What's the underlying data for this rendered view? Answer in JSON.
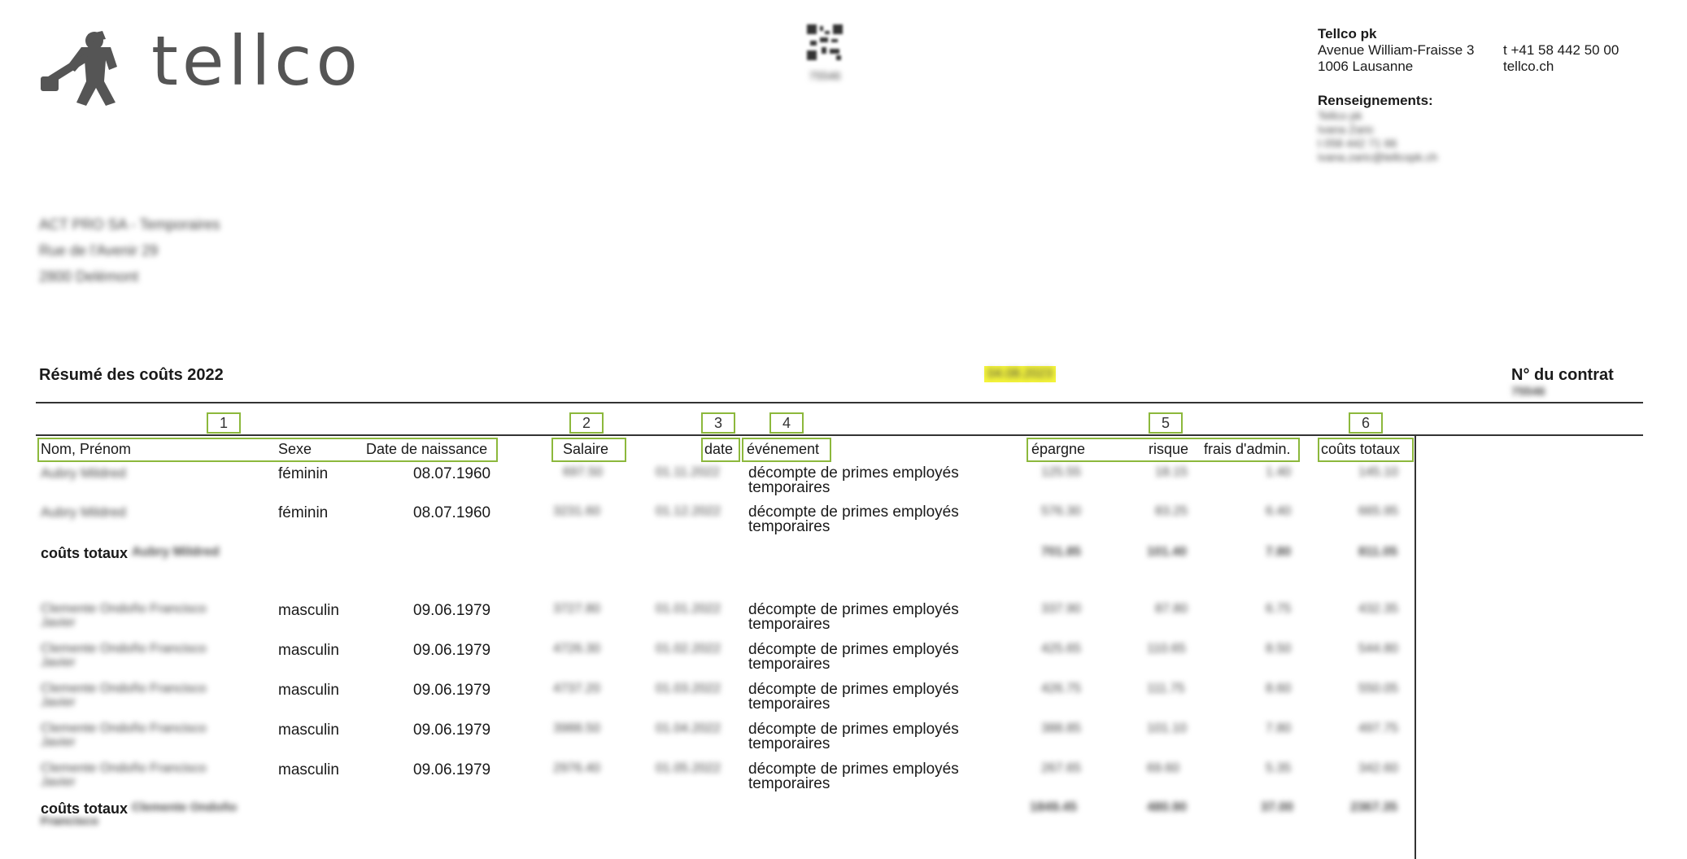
{
  "header": {
    "logo_text": "tellco",
    "qr_code_label": "75546",
    "company": {
      "name": "Tellco pk",
      "address_line1": "Avenue William-Fraisse 3",
      "address_line2": "1006 Lausanne",
      "phone": "t +41 58 442 50 00",
      "website": "tellco.ch",
      "info_label": "Renseignements:",
      "contact_line1": "Tellco pk",
      "contact_line2": "Ivana Zaric",
      "contact_line3": "t 058 442 71 66",
      "contact_line4": "ivana.zaric@tellcopk.ch"
    }
  },
  "recipient": {
    "line1": "ACT PRO SA - Temporaires",
    "line2": "Rue de l'Avenir 29",
    "line3": "2800 Delémont"
  },
  "summary": {
    "title": "Résumé des coûts 2022",
    "date": "04.08.2023",
    "contract_label": "N° du contrat",
    "contract_number": "75546"
  },
  "columns": {
    "numbers": [
      "1",
      "2",
      "3",
      "4",
      "5",
      "6"
    ],
    "name": "Nom, Prénom",
    "sex": "Sexe",
    "birth": "Date de naissance",
    "salary": "Salaire",
    "date": "date",
    "event": "événement",
    "savings": "épargne",
    "risk": "risque",
    "admin": "frais d'admin.",
    "total": "coûts totaux"
  },
  "groups": [
    {
      "rows": [
        {
          "name": "Aubry Mildred",
          "sex": "féminin",
          "birth": "08.07.1960",
          "salary": "697.50",
          "date": "01.11.2022",
          "event_line1": "décompte de primes employés",
          "event_line2": "temporaires",
          "savings": "125.55",
          "risk": "18.15",
          "admin": "1.40",
          "total": "145.10"
        },
        {
          "name": "Aubry Mildred",
          "sex": "féminin",
          "birth": "08.07.1960",
          "salary": "3231.60",
          "date": "01.12.2022",
          "event_line1": "décompte de primes employés",
          "event_line2": "temporaires",
          "savings": "576.30",
          "risk": "83.25",
          "admin": "6.40",
          "total": "665.95"
        }
      ],
      "total_label": "coûts totaux",
      "total_name": "Aubry Mildred",
      "totals": {
        "savings": "701.85",
        "risk": "101.40",
        "admin": "7.80",
        "total": "811.05"
      }
    },
    {
      "rows": [
        {
          "name_line1": "Clemente Ondoño Francisco",
          "name_line2": "Javier",
          "sex": "masculin",
          "birth": "09.06.1979",
          "salary": "3727.80",
          "date": "01.01.2022",
          "event_line1": "décompte de primes employés",
          "event_line2": "temporaires",
          "savings": "337.90",
          "risk": "87.80",
          "admin": "6.75",
          "total": "432.35"
        },
        {
          "name_line1": "Clemente Ondoño Francisco",
          "name_line2": "Javier",
          "sex": "masculin",
          "birth": "09.06.1979",
          "salary": "4726.30",
          "date": "01.02.2022",
          "event_line1": "décompte de primes employés",
          "event_line2": "temporaires",
          "savings": "425.65",
          "risk": "110.65",
          "admin": "8.50",
          "total": "544.80"
        },
        {
          "name_line1": "Clemente Ondoño Francisco",
          "name_line2": "Javier",
          "sex": "masculin",
          "birth": "09.06.1979",
          "salary": "4737.20",
          "date": "01.03.2022",
          "event_line1": "décompte de primes employés",
          "event_line2": "temporaires",
          "savings": "426.75",
          "risk": "111.75",
          "admin": "8.60",
          "total": "550.05"
        },
        {
          "name_line1": "Clemente Ondoño Francisco",
          "name_line2": "Javier",
          "sex": "masculin",
          "birth": "09.06.1979",
          "salary": "3988.50",
          "date": "01.04.2022",
          "event_line1": "décompte de primes employés",
          "event_line2": "temporaires",
          "savings": "388.85",
          "risk": "101.10",
          "admin": "7.80",
          "total": "497.75"
        },
        {
          "name_line1": "Clemente Ondoño Francisco",
          "name_line2": "Javier",
          "sex": "masculin",
          "birth": "09.06.1979",
          "salary": "2976.40",
          "date": "01.05.2022",
          "event_line1": "décompte de primes employés",
          "event_line2": "temporaires",
          "savings": "267.65",
          "risk": "69.60",
          "admin": "5.35",
          "total": "342.60"
        }
      ],
      "total_label": "coûts totaux",
      "total_name_line1": "Clemente Ondoño",
      "total_name_line2": "Francisco",
      "totals": {
        "savings": "1849.45",
        "risk": "480.90",
        "admin": "37.00",
        "total": "2367.35"
      }
    }
  ]
}
